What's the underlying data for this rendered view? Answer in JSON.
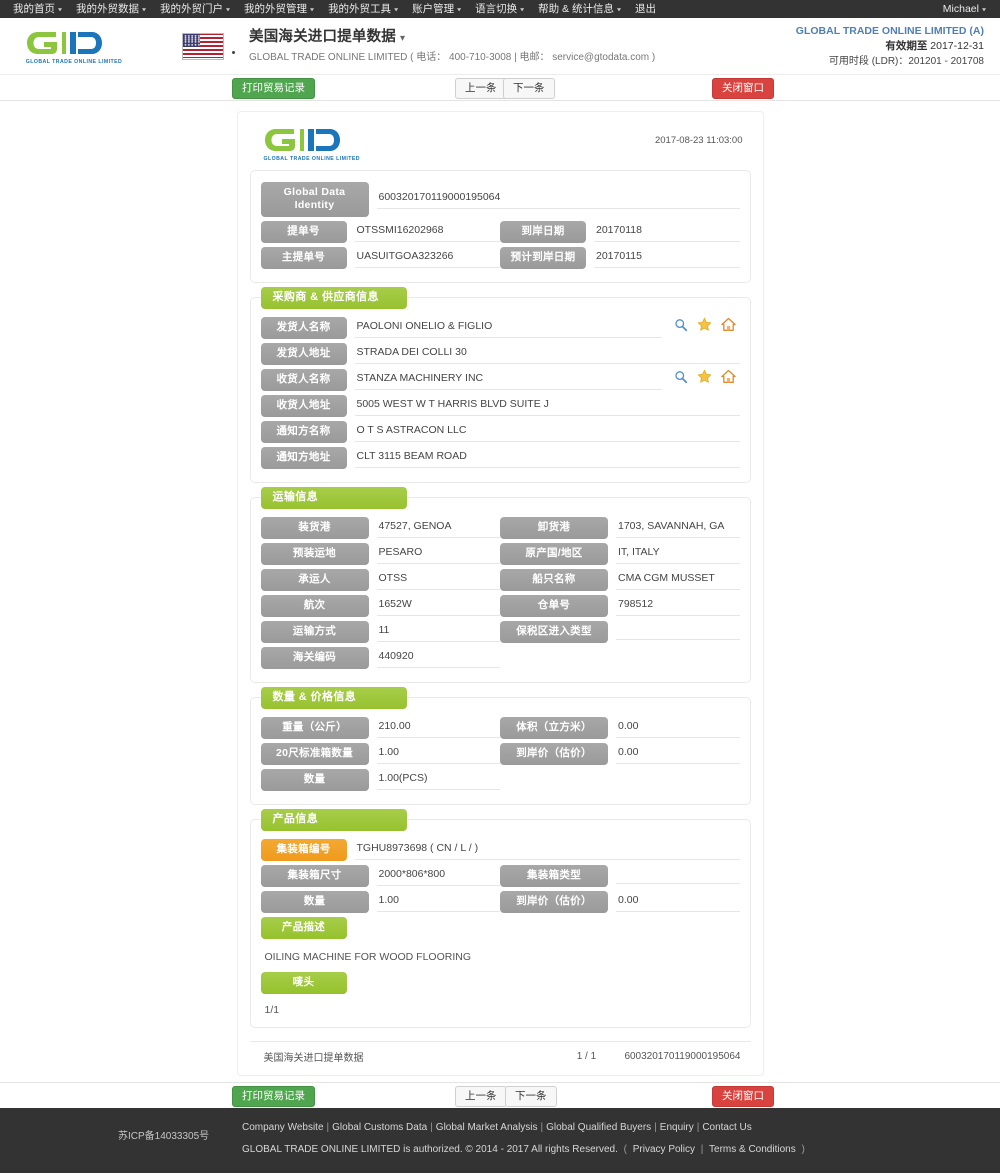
{
  "topnav": {
    "items": [
      {
        "label": "我的首页",
        "caret": true
      },
      {
        "label": "我的外贸数据",
        "caret": true
      },
      {
        "label": "我的外贸门户",
        "caret": true
      },
      {
        "label": "我的外贸管理",
        "caret": true
      },
      {
        "label": "我的外贸工具",
        "caret": true
      },
      {
        "label": "账户管理",
        "caret": true
      },
      {
        "label": "语言切换",
        "caret": true
      },
      {
        "label": "帮助 & 统计信息",
        "caret": true
      },
      {
        "label": "退出",
        "caret": false
      }
    ],
    "user": "Michael"
  },
  "header": {
    "logo_text": "GLOBAL TRADE ONLINE LIMITED",
    "flag": "us-flag-icon",
    "title": "美国海关进口提单数据",
    "subtitle": "GLOBAL TRADE ONLINE LIMITED ( 电话： 400-710-3008 | 电邮： service@gtodata.com )",
    "company": "GLOBAL TRADE ONLINE LIMITED (A)",
    "valid_label": "有效期至",
    "valid_date": "2017-12-31",
    "range": "可用时段 (LDR)：201201 - 201708"
  },
  "toolbar": {
    "print_label": "打印贸易记录",
    "prev_label": "上一条",
    "next_label": "下一条",
    "close_label": "关闭窗口"
  },
  "doc": {
    "timestamp": "2017-08-23 11:03:00",
    "identity": {
      "label": "Global Data Identity",
      "value": "600320170119000195064"
    },
    "top_fields": [
      {
        "label": "提单号",
        "value": "OTSSMI16202968"
      },
      {
        "label": "到岸日期",
        "value": "20170118"
      },
      {
        "label": "主提单号",
        "value": "UASUITGOA323266"
      },
      {
        "label": "预计到岸日期",
        "value": "20170115"
      }
    ],
    "sections": {
      "parties": {
        "title": "采购商 & 供应商信息",
        "rows": [
          {
            "label": "发货人名称",
            "value": "PAOLONI ONELIO & FIGLIO",
            "icons": true
          },
          {
            "label": "发货人地址",
            "value": "STRADA DEI COLLI 30",
            "icons": false
          },
          {
            "label": "收货人名称",
            "value": "STANZA MACHINERY INC",
            "icons": true
          },
          {
            "label": "收货人地址",
            "value": "5005 WEST W T HARRIS BLVD SUITE J",
            "icons": false
          },
          {
            "label": "通知方名称",
            "value": "O T S ASTRACON LLC",
            "icons": false
          },
          {
            "label": "通知方地址",
            "value": "CLT 3115 BEAM ROAD",
            "icons": false
          }
        ]
      },
      "transport": {
        "title": "运输信息",
        "rows": [
          {
            "l_label": "装货港",
            "l_value": "47527, GENOA",
            "r_label": "卸货港",
            "r_value": "1703, SAVANNAH, GA"
          },
          {
            "l_label": "预装运地",
            "l_value": "PESARO",
            "r_label": "原产国/地区",
            "r_value": "IT, ITALY"
          },
          {
            "l_label": "承运人",
            "l_value": "OTSS",
            "r_label": "船只名称",
            "r_value": "CMA CGM MUSSET"
          },
          {
            "l_label": "航次",
            "l_value": "1652W",
            "r_label": "仓单号",
            "r_value": "798512"
          },
          {
            "l_label": "运输方式",
            "l_value": "11",
            "r_label": "保税区进入类型",
            "r_value": ""
          },
          {
            "l_label": "海关编码",
            "l_value": "440920",
            "r_label": "",
            "r_value": ""
          }
        ]
      },
      "quantity": {
        "title": "数量 & 价格信息",
        "rows": [
          {
            "l_label": "重量（公斤）",
            "l_value": "210.00",
            "r_label": "体积（立方米）",
            "r_value": "0.00"
          },
          {
            "l_label": "20尺标准箱数量",
            "l_value": "1.00",
            "r_label": "到岸价（估价）",
            "r_value": "0.00"
          },
          {
            "l_label": "数量",
            "l_value": "1.00(PCS)",
            "r_label": "",
            "r_value": ""
          }
        ]
      },
      "product": {
        "title": "产品信息",
        "container_label": "集装箱编号",
        "container_value": "TGHU8973698 ( CN / L / )",
        "rows": [
          {
            "l_label": "集装箱尺寸",
            "l_value": "2000*806*800",
            "r_label": "集装箱类型",
            "r_value": ""
          },
          {
            "l_label": "数量",
            "l_value": "1.00",
            "r_label": "到岸价（估价）",
            "r_value": "0.00"
          }
        ],
        "desc_label": "产品描述",
        "desc_value": "OILING MACHINE FOR WOOD FLOORING",
        "marks_label": "唛头",
        "marks_value": "1/1"
      }
    },
    "footer": {
      "source": "美国海关进口提单数据",
      "page": "1 / 1",
      "identity": "600320170119000195064"
    }
  },
  "footer": {
    "icp": "苏ICP备14033305号",
    "links": [
      "Company Website",
      "Global Customs Data",
      "Global Market Analysis",
      "Global Qualified Buyers",
      "Enquiry",
      "Contact Us"
    ],
    "copyright": "GLOBAL TRADE ONLINE LIMITED is authorized. © 2014 - 2017 All rights Reserved.",
    "legal_open": "(",
    "privacy": "Privacy Policy",
    "terms": "Terms & Conditions",
    "legal_close": ")"
  },
  "colors": {
    "nav_bg": "#333333",
    "green": "#a7cd4a",
    "orange": "#f3a933",
    "gray_label": "#a0a0a0",
    "accent_blue": "#4f7fb5",
    "danger": "#d9433f",
    "success": "#4fa64f"
  }
}
